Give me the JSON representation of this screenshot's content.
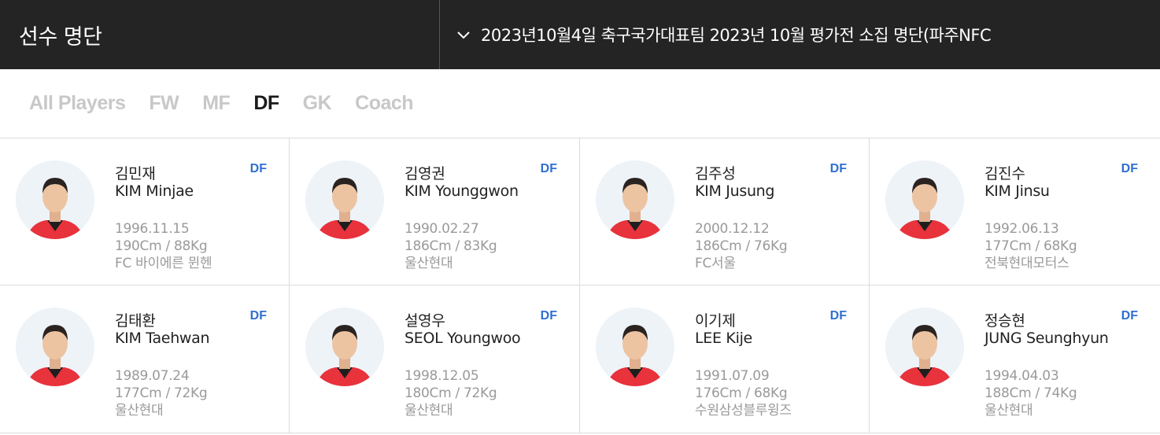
{
  "header": {
    "title": "선수 명단",
    "roster_select": "2023년10월4일 축구국가대표팀 2023년 10월 평가전 소집 명단(파주NFC"
  },
  "tabs": [
    {
      "label": "All Players",
      "active": false
    },
    {
      "label": "FW",
      "active": false
    },
    {
      "label": "MF",
      "active": false
    },
    {
      "label": "DF",
      "active": true
    },
    {
      "label": "GK",
      "active": false
    },
    {
      "label": "Coach",
      "active": false
    }
  ],
  "players": [
    {
      "name_ko": "김민재",
      "name_en": "KIM Minjae",
      "position": "DF",
      "birth": "1996.11.15",
      "body": "190Cm / 88Kg",
      "club": "FC 바이에른 뮌헨"
    },
    {
      "name_ko": "김영권",
      "name_en": "KIM Younggwon",
      "position": "DF",
      "birth": "1990.02.27",
      "body": "186Cm / 83Kg",
      "club": "울산현대"
    },
    {
      "name_ko": "김주성",
      "name_en": "KIM Jusung",
      "position": "DF",
      "birth": "2000.12.12",
      "body": "186Cm / 76Kg",
      "club": "FC서울"
    },
    {
      "name_ko": "김진수",
      "name_en": "KIM Jinsu",
      "position": "DF",
      "birth": "1992.06.13",
      "body": "177Cm / 68Kg",
      "club": "전북현대모터스"
    },
    {
      "name_ko": "김태환",
      "name_en": "KIM Taehwan",
      "position": "DF",
      "birth": "1989.07.24",
      "body": "177Cm / 72Kg",
      "club": "울산현대"
    },
    {
      "name_ko": "설영우",
      "name_en": "SEOL Youngwoo",
      "position": "DF",
      "birth": "1998.12.05",
      "body": "180Cm / 72Kg",
      "club": "울산현대"
    },
    {
      "name_ko": "이기제",
      "name_en": "LEE Kije",
      "position": "DF",
      "birth": "1991.07.09",
      "body": "176Cm / 68Kg",
      "club": "수원삼성블루윙즈"
    },
    {
      "name_ko": "정승현",
      "name_en": "JUNG Seunghyun",
      "position": "DF",
      "birth": "1994.04.03",
      "body": "188Cm / 74Kg",
      "club": "울산현대"
    }
  ],
  "colors": {
    "header_bg": "#242424",
    "position_blue": "#2f6fd1",
    "jersey_red": "#e8323c"
  }
}
